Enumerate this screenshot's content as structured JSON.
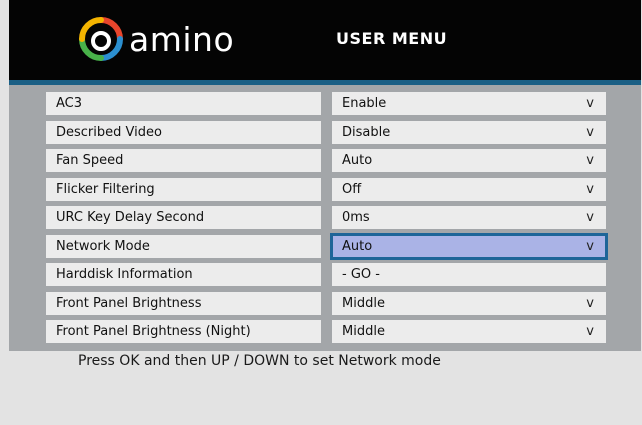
{
  "header": {
    "logo_text": "amino",
    "title": "USER MENU"
  },
  "colors": {
    "header_bg": "#040404",
    "accent_rule": "#1a5f85",
    "panel_bg": "#a3a6a9",
    "cell_bg": "#ececec",
    "selected_bg": "#aab3e6",
    "selected_border": "#1e6598"
  },
  "menu": {
    "rows": [
      {
        "label": "AC3",
        "value": "Enable",
        "chevron": "v"
      },
      {
        "label": "Described Video",
        "value": "Disable",
        "chevron": "v"
      },
      {
        "label": "Fan Speed",
        "value": "Auto",
        "chevron": "v"
      },
      {
        "label": "Flicker Filtering",
        "value": "Off",
        "chevron": "v"
      },
      {
        "label": "URC Key Delay Second",
        "value": "0ms",
        "chevron": "v"
      },
      {
        "label": "Network Mode",
        "value": "Auto",
        "chevron": "v",
        "selected": true
      },
      {
        "label": "Harddisk Information",
        "value": "- GO -",
        "chevron": ""
      },
      {
        "label": "Front Panel Brightness",
        "value": "Middle",
        "chevron": "v"
      },
      {
        "label": "Front Panel Brightness (Night)",
        "value": "Middle",
        "chevron": "v"
      }
    ]
  },
  "footer": {
    "hint": "Press OK and then UP / DOWN to set Network mode"
  }
}
